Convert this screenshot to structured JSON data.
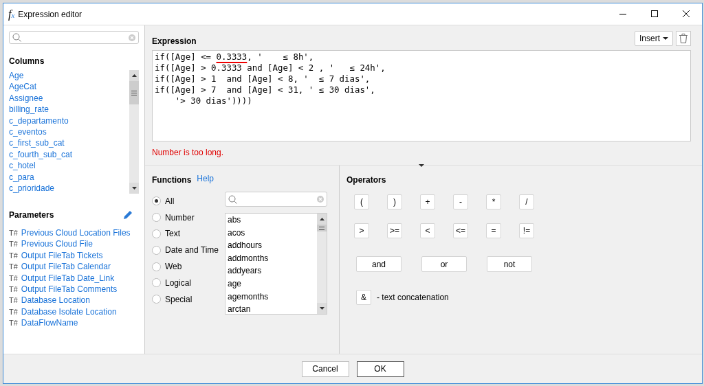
{
  "window": {
    "icon_glyphs": [
      "f",
      "x"
    ],
    "title": "Expression editor"
  },
  "columns": {
    "heading": "Columns",
    "items": [
      "Age",
      "AgeCat",
      "Assignee",
      "billing_rate",
      "c_departamento",
      "c_eventos",
      "c_first_sub_cat",
      "c_fourth_sub_cat",
      "c_hotel",
      "c_para",
      "c_prioridade"
    ]
  },
  "parameters": {
    "heading": "Parameters",
    "items": [
      {
        "type": "T#",
        "name": "Previous Cloud Location Files"
      },
      {
        "type": "T#",
        "name": "Previous Cloud File"
      },
      {
        "type": "T#",
        "name": "Output FileTab Tickets"
      },
      {
        "type": "T#",
        "name": "Output FileTab Calendar"
      },
      {
        "type": "T#",
        "name": "Output FileTab Date_Link"
      },
      {
        "type": "T#",
        "name": "Output FileTab Comments"
      },
      {
        "type": "T#",
        "name": "Database Location"
      },
      {
        "type": "T#",
        "name": "Database Isolate Location"
      },
      {
        "type": "T#",
        "name": "DataFlowName"
      }
    ]
  },
  "expression": {
    "heading": "Expression",
    "insert_button": "Insert",
    "lines": [
      [
        {
          "text": "if([Age] <= "
        },
        {
          "text": "0.3333",
          "error": true
        },
        {
          "text": ", '    ≤ 8h',"
        }
      ],
      [
        {
          "text": "if([Age] > 0.3333 and [Age] < 2 , '   ≤ 24h',"
        }
      ],
      [
        {
          "text": "if([Age] > 1  and [Age] < 8, '  ≤ 7 dias',"
        }
      ],
      [
        {
          "text": "if([Age] > 7  and [Age] < 31, ' ≤ 30 dias',"
        }
      ],
      [
        {
          "text": "    '> 30 dias'))))"
        }
      ]
    ],
    "error_message": "Number is too long."
  },
  "functions": {
    "heading": "Functions",
    "help_link": "Help",
    "categories": [
      {
        "label": "All",
        "selected": true
      },
      {
        "label": "Number",
        "selected": false
      },
      {
        "label": "Text",
        "selected": false
      },
      {
        "label": "Date and Time",
        "selected": false
      },
      {
        "label": "Web",
        "selected": false
      },
      {
        "label": "Logical",
        "selected": false
      },
      {
        "label": "Special",
        "selected": false
      }
    ],
    "items": [
      "abs",
      "acos",
      "addhours",
      "addmonths",
      "addyears",
      "age",
      "agemonths",
      "arctan"
    ]
  },
  "operators": {
    "heading": "Operators",
    "rows": [
      [
        "(",
        ")",
        "+",
        "-",
        "*",
        "/"
      ],
      [
        ">",
        ">=",
        "<",
        "<=",
        "=",
        "!="
      ]
    ],
    "logical": [
      "and",
      "or",
      "not"
    ],
    "concat": {
      "symbol": "&",
      "description": "- text concatenation"
    }
  },
  "buttons": [
    "Cancel",
    "OK"
  ]
}
